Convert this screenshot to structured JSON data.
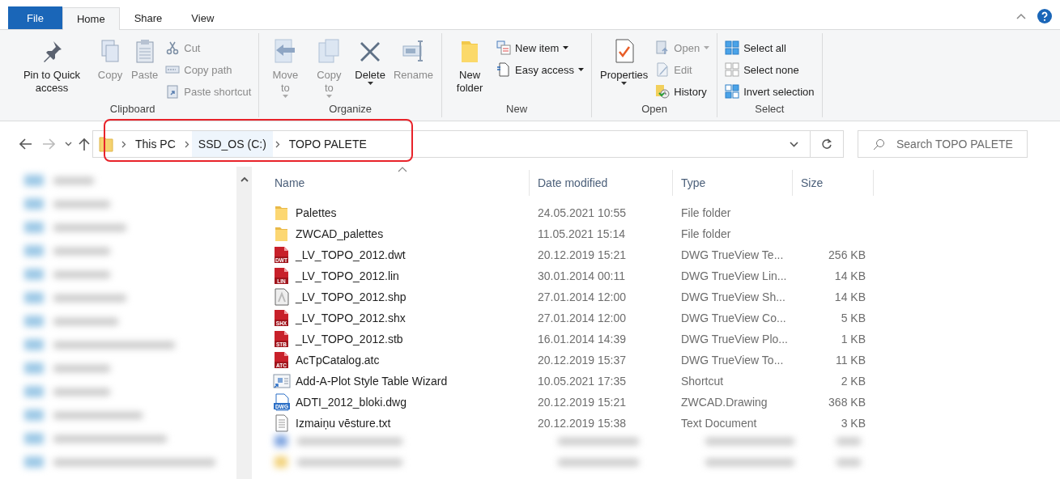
{
  "tabs": [
    {
      "label": "File",
      "kind": "file",
      "selected": false
    },
    {
      "label": "Home",
      "kind": "tab",
      "selected": true
    },
    {
      "label": "Share",
      "kind": "tab",
      "selected": false
    },
    {
      "label": "View",
      "kind": "tab",
      "selected": false
    }
  ],
  "ribbon": {
    "groups": [
      {
        "label": "Clipboard",
        "items": [
          {
            "label": "Pin to Quick access",
            "kind": "large",
            "disabled": false,
            "dropdown": false
          },
          {
            "label": "Copy",
            "kind": "large",
            "disabled": true,
            "dropdown": false
          },
          {
            "label": "Paste",
            "kind": "large",
            "disabled": true,
            "dropdown": false
          },
          {
            "label": "Cut",
            "kind": "small",
            "disabled": true,
            "dropdown": false
          },
          {
            "label": "Copy path",
            "kind": "small",
            "disabled": true,
            "dropdown": false
          },
          {
            "label": "Paste shortcut",
            "kind": "small",
            "disabled": true,
            "dropdown": false
          }
        ]
      },
      {
        "label": "Organize",
        "items": [
          {
            "label": "Move to",
            "kind": "large",
            "disabled": true,
            "dropdown": true
          },
          {
            "label": "Copy to",
            "kind": "large",
            "disabled": true,
            "dropdown": true
          },
          {
            "label": "Delete",
            "kind": "large",
            "disabled": false,
            "dropdown": true
          },
          {
            "label": "Rename",
            "kind": "large",
            "disabled": true,
            "dropdown": false
          }
        ]
      },
      {
        "label": "New",
        "items": [
          {
            "label": "New folder",
            "kind": "large",
            "disabled": false,
            "dropdown": false
          },
          {
            "label": "New item",
            "kind": "small",
            "disabled": false,
            "dropdown": true
          },
          {
            "label": "Easy access",
            "kind": "small",
            "disabled": false,
            "dropdown": true
          }
        ]
      },
      {
        "label": "Open",
        "items": [
          {
            "label": "Properties",
            "kind": "large",
            "disabled": false,
            "dropdown": true
          },
          {
            "label": "Open",
            "kind": "small",
            "disabled": true,
            "dropdown": true
          },
          {
            "label": "Edit",
            "kind": "small",
            "disabled": true,
            "dropdown": false
          },
          {
            "label": "History",
            "kind": "small",
            "disabled": false,
            "dropdown": false
          }
        ]
      },
      {
        "label": "Select",
        "items": [
          {
            "label": "Select all",
            "kind": "small",
            "disabled": false,
            "dropdown": false
          },
          {
            "label": "Select none",
            "kind": "small",
            "disabled": false,
            "dropdown": false
          },
          {
            "label": "Invert selection",
            "kind": "small",
            "disabled": false,
            "dropdown": false
          }
        ]
      }
    ]
  },
  "address_bar": {
    "segments": [
      {
        "label": "This PC",
        "selected": false
      },
      {
        "label": "SSD_OS (C:)",
        "selected": true
      },
      {
        "label": "TOPO PALETE",
        "selected": false
      }
    ]
  },
  "search": {
    "placeholder": "Search TOPO PALETE"
  },
  "sidebar": {
    "items": [
      {
        "kind": "blurred"
      },
      {
        "kind": "blurred"
      },
      {
        "kind": "blurred"
      },
      {
        "kind": "blurred"
      },
      {
        "kind": "blurred"
      },
      {
        "kind": "blurred"
      },
      {
        "kind": "blurred"
      },
      {
        "kind": "blurred"
      },
      {
        "kind": "blurred"
      },
      {
        "kind": "blurred"
      },
      {
        "kind": "blurred"
      },
      {
        "kind": "blurred"
      },
      {
        "kind": "blurred"
      }
    ]
  },
  "table": {
    "columns": [
      {
        "label": "Name",
        "sorted": true
      },
      {
        "label": "Date modified",
        "sorted": false
      },
      {
        "label": "Type",
        "sorted": false
      },
      {
        "label": "Size",
        "sorted": false
      }
    ],
    "rows": [
      {
        "kind": "folder",
        "name": "Palettes",
        "date": "24.05.2021 10:55",
        "type": "File folder"
      },
      {
        "kind": "folder",
        "name": "ZWCAD_palettes",
        "date": "11.05.2021 15:14",
        "type": "File folder"
      },
      {
        "kind": "cad",
        "badge": "DWT",
        "name": "_LV_TOPO_2012.dwt",
        "date": "20.12.2019 15:21",
        "type": "DWG TrueView Te...",
        "size": "256 KB"
      },
      {
        "kind": "cad",
        "badge": "LIN",
        "name": "_LV_TOPO_2012.lin",
        "date": "30.01.2014 00:11",
        "type": "DWG TrueView Lin...",
        "size": "14 KB"
      },
      {
        "kind": "shape",
        "name": "_LV_TOPO_2012.shp",
        "date": "27.01.2014 12:00",
        "type": "DWG TrueView Sh...",
        "size": "14 KB"
      },
      {
        "kind": "cad",
        "badge": "SHX",
        "name": "_LV_TOPO_2012.shx",
        "date": "27.01.2014 12:00",
        "type": "DWG TrueView Co...",
        "size": "5 KB"
      },
      {
        "kind": "cad",
        "badge": "STB",
        "name": "_LV_TOPO_2012.stb",
        "date": "16.01.2014 14:39",
        "type": "DWG TrueView Plo...",
        "size": "1 KB"
      },
      {
        "kind": "cad",
        "badge": "ATC",
        "name": "AcTpCatalog.atc",
        "date": "20.12.2019 15:37",
        "type": "DWG TrueView To...",
        "size": "11 KB"
      },
      {
        "kind": "shortcut",
        "name": "Add-A-Plot Style Table Wizard",
        "date": "10.05.2021 17:35",
        "type": "Shortcut",
        "size": "2 KB"
      },
      {
        "kind": "drawing",
        "badge": "DWG",
        "name": "ADTI_2012_bloki.dwg",
        "date": "20.12.2019 15:21",
        "type": "ZWCAD.Drawing",
        "size": "368 KB"
      },
      {
        "kind": "text",
        "name": "Izmaiņu vēsture.txt",
        "date": "20.12.2019 15:38",
        "type": "Text Document",
        "size": "3 KB"
      },
      {
        "kind": "blurred"
      },
      {
        "kind": "blurred"
      }
    ]
  }
}
